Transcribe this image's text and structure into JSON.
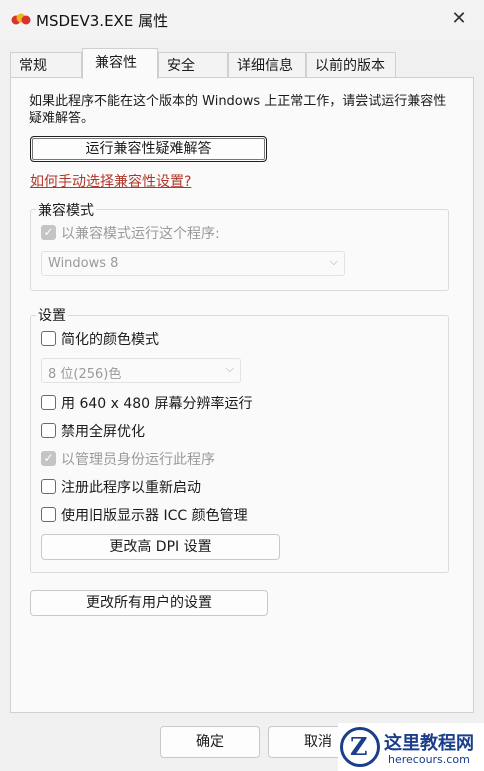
{
  "window": {
    "title": "MSDEV3.EXE 属性",
    "close_icon": "close-icon"
  },
  "tabs": [
    {
      "label": "常规"
    },
    {
      "label": "兼容性",
      "active": true
    },
    {
      "label": "安全"
    },
    {
      "label": "详细信息"
    },
    {
      "label": "以前的版本"
    }
  ],
  "compat": {
    "description": "如果此程序不能在这个版本的 Windows 上正常工作，请尝试运行兼容性疑难解答。",
    "troubleshoot_button": "运行兼容性疑难解答",
    "manual_link": "如何手动选择兼容性设置?"
  },
  "compat_mode": {
    "group_label": "兼容模式",
    "checkbox_label": "以兼容模式运行这个程序:",
    "os_select": "Windows 8"
  },
  "settings": {
    "group_label": "设置",
    "reduced_color": "简化的颜色模式",
    "color_select": "8 位(256)色",
    "resolution_640": "用 640 x 480 屏幕分辨率运行",
    "disable_fullscreen": "禁用全屏优化",
    "run_as_admin": "以管理员身份运行此程序",
    "register_restart": "注册此程序以重新启动",
    "legacy_icc": "使用旧版显示器 ICC 颜色管理",
    "dpi_button": "更改高 DPI 设置"
  },
  "all_users_button": "更改所有用户的设置",
  "footer": {
    "ok": "确定",
    "cancel": "取消"
  },
  "watermark": {
    "title": "这里教程网",
    "subtitle": "herecours.com"
  }
}
